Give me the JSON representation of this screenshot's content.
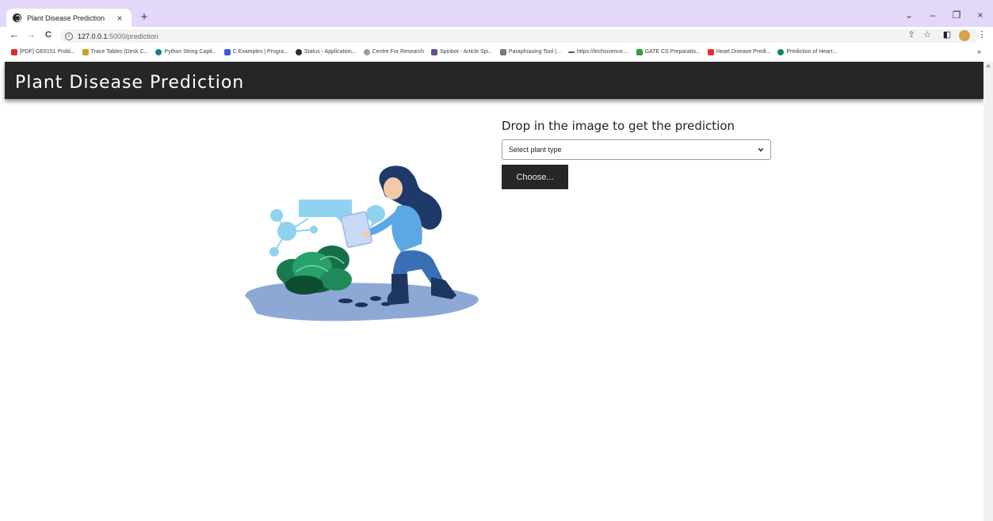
{
  "browser": {
    "tab_title": "Plant Disease Prediction",
    "tab_close": "×",
    "new_tab": "+",
    "window_controls": [
      "⌄",
      "–",
      "❐",
      "×"
    ],
    "nav": {
      "back": "←",
      "forward": "→",
      "reload": "C"
    },
    "url_host": "127.0.0.1",
    "url_path": ":5000/prediction",
    "toolbar_icons": [
      "share-icon",
      "star-icon",
      "sidebar-icon",
      "avatar-icon",
      "menu-icon"
    ],
    "bookmarks": [
      {
        "label": "[PDF] GE8151 Probl...",
        "color": "#d93025"
      },
      {
        "label": "Trace Tables (Desk C...",
        "color": "#c9a227"
      },
      {
        "label": "Python String Capit...",
        "color": "#1a7f8e"
      },
      {
        "label": "C Examples | Progra...",
        "color": "#3b5bdb"
      },
      {
        "label": "Status - Application...",
        "color": "#2b2b2b"
      },
      {
        "label": "Centre For Research",
        "color": "#9e9e9e"
      },
      {
        "label": "Spinbot - Article Spi...",
        "color": "#6a4c93"
      },
      {
        "label": "Paraphrasing Tool |...",
        "color": "#7a7a7a"
      },
      {
        "label": "https://techscience....",
        "color": "#555555"
      },
      {
        "label": "GATE CS Preparatio...",
        "color": "#2f9e44"
      },
      {
        "label": "Heart Disease Predi...",
        "color": "#e03131"
      },
      {
        "label": "Prediction of Heart...",
        "color": "#0b8a57"
      }
    ],
    "bookmarks_more": "»"
  },
  "header": {
    "brand": "Plant Disease Prediction"
  },
  "main": {
    "heading": "Drop in the image to get the prediction",
    "select": {
      "selected": "Select plant type"
    },
    "choose_label": "Choose..."
  },
  "colors": {
    "header_bg": "#262628",
    "tabstrip_bg": "#e3d7fa",
    "button_bg": "#262628"
  }
}
